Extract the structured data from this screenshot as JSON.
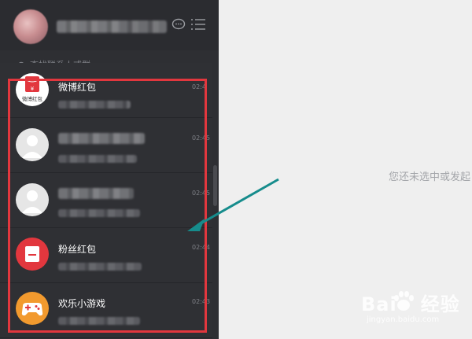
{
  "header": {
    "username_blurred": "████████",
    "icons": [
      "chat-bubble-icon",
      "menu-list-icon"
    ]
  },
  "search": {
    "placeholder": "查找联系人或群"
  },
  "chats": [
    {
      "name": "微博红包",
      "time": "02:4",
      "avatar": "weibo-red-packet-icon",
      "avatar_label": "微博红包"
    },
    {
      "name": "",
      "time": "02:45",
      "avatar": "default-user-avatar",
      "blurred": true
    },
    {
      "name": "",
      "time": "02:45",
      "avatar": "default-user-avatar",
      "blurred": true
    },
    {
      "name": "粉丝红包",
      "time": "02:44",
      "avatar": "fan-red-packet-icon"
    },
    {
      "name": "欢乐小游戏",
      "time": "02:43",
      "avatar": "gamepad-icon"
    }
  ],
  "main": {
    "empty_state": "您还未选中或发起"
  },
  "watermark": {
    "brand": "Bai",
    "suffix": "经验",
    "url": "jingyan.baidu.com"
  },
  "colors": {
    "sidebar_bg": "#2e2f33",
    "highlight_border": "#e2373e",
    "arrow": "#168c8c",
    "red_packet": "#e2373e",
    "game_orange": "#f29a2e"
  }
}
